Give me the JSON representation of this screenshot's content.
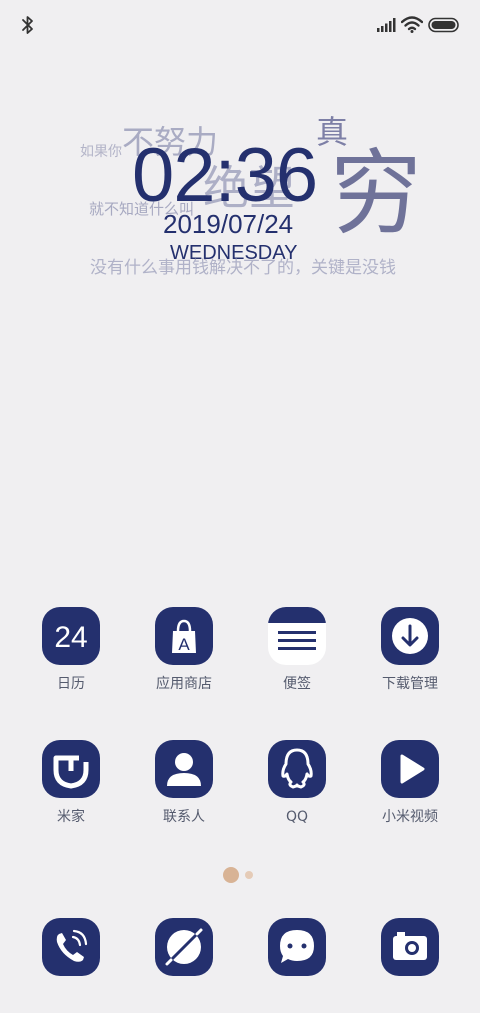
{
  "status_bar": {
    "bluetooth_icon": "bluetooth-icon",
    "signal_icon": "signal-icon",
    "wifi_icon": "wifi-icon",
    "battery_icon": "battery-icon"
  },
  "widget": {
    "deco_line1_small": "如果你",
    "deco_line1_big": "不努力",
    "deco_zhen": "真",
    "deco_jue": "绝望",
    "deco_qiong": "穷",
    "deco_line2": "就不知道什么叫",
    "deco_line3": "没有什么事用钱解决不了的，关键是没钱",
    "time": "02:36",
    "date": "2019/07/24",
    "weekday": "WEDNESDAY"
  },
  "apps_row1": [
    {
      "label": "日历",
      "icon": "calendar-icon",
      "badge": "24"
    },
    {
      "label": "应用商店",
      "icon": "app-store-icon",
      "glyph": "A"
    },
    {
      "label": "便签",
      "icon": "notes-icon"
    },
    {
      "label": "下载管理",
      "icon": "download-icon"
    }
  ],
  "apps_row2": [
    {
      "label": "米家",
      "icon": "mijia-icon"
    },
    {
      "label": "联系人",
      "icon": "contacts-icon"
    },
    {
      "label": "QQ",
      "icon": "qq-icon"
    },
    {
      "label": "小米视频",
      "icon": "video-play-icon"
    }
  ],
  "dock": [
    {
      "icon": "phone-icon"
    },
    {
      "icon": "browser-icon"
    },
    {
      "icon": "messages-icon"
    },
    {
      "icon": "camera-icon"
    }
  ],
  "pager": {
    "pages": 2,
    "current": 1
  },
  "colors": {
    "background": "#f0eff1",
    "accent": "#24306e",
    "deco_text": "#9a9cb8",
    "dot_active": "#d8b395",
    "dot": "#e5cbb7",
    "label": "#555b6e"
  }
}
